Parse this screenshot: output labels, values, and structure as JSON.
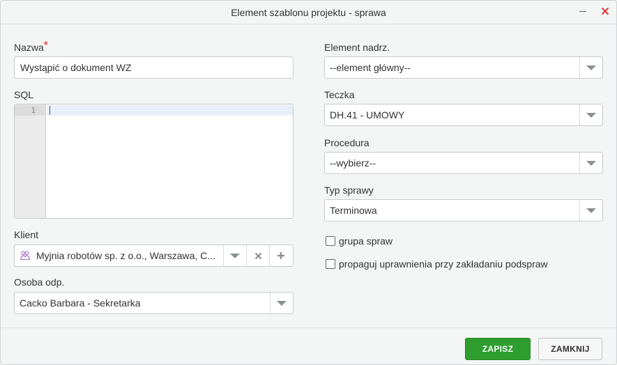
{
  "dialog": {
    "title": "Element szablonu projektu - sprawa"
  },
  "fields": {
    "nazwa": {
      "label": "Nazwa",
      "required_mark": "*",
      "value": "Wystąpić o dokument WZ"
    },
    "sql": {
      "label": "SQL",
      "line_number": "1",
      "value": ""
    },
    "klient": {
      "label": "Klient",
      "value": "Myjnia robotów sp. z o.o., Warszawa, C...",
      "icon": "client-icon"
    },
    "osoba": {
      "label": "Osoba odp.",
      "value": "Cacko Barbara - Sekretarka"
    },
    "element_nadrz": {
      "label": "Element nadrz.",
      "value": "--element główny--"
    },
    "teczka": {
      "label": "Teczka",
      "value": "DH.41 - UMOWY"
    },
    "procedura": {
      "label": "Procedura",
      "value": "--wybierz--"
    },
    "typ_sprawy": {
      "label": "Typ sprawy",
      "value": "Terminowa"
    },
    "grupa_spraw": {
      "label": "grupa spraw",
      "checked": false
    },
    "propaguj": {
      "label": "propaguj uprawnienia przy zakładaniu podspraw",
      "checked": false
    }
  },
  "buttons": {
    "save": "ZAPISZ",
    "close": "ZAMKNIJ"
  },
  "colors": {
    "save_button": "#2e9e2e",
    "close_icon": "#e02020",
    "required_mark": "#e02020",
    "client_icon": "#9a63c6"
  }
}
